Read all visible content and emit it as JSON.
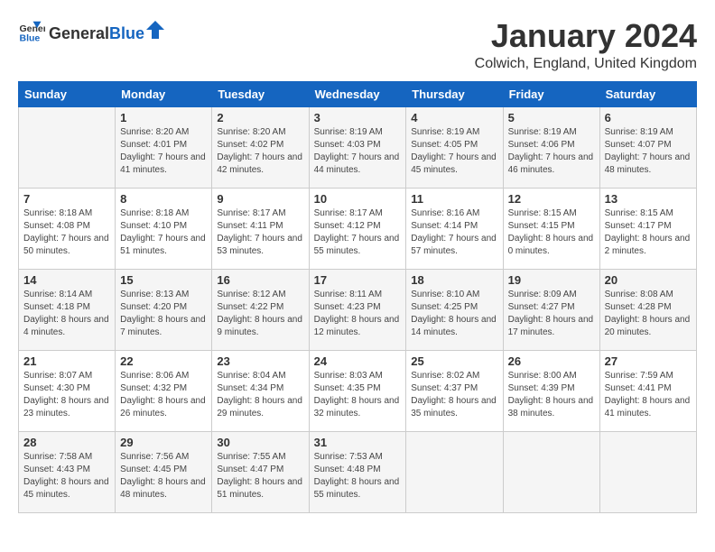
{
  "header": {
    "logo_general": "General",
    "logo_blue": "Blue",
    "month_title": "January 2024",
    "location": "Colwich, England, United Kingdom"
  },
  "days_of_week": [
    "Sunday",
    "Monday",
    "Tuesday",
    "Wednesday",
    "Thursday",
    "Friday",
    "Saturday"
  ],
  "weeks": [
    [
      {
        "day": "",
        "sunrise": "",
        "sunset": "",
        "daylight": ""
      },
      {
        "day": "1",
        "sunrise": "Sunrise: 8:20 AM",
        "sunset": "Sunset: 4:01 PM",
        "daylight": "Daylight: 7 hours and 41 minutes."
      },
      {
        "day": "2",
        "sunrise": "Sunrise: 8:20 AM",
        "sunset": "Sunset: 4:02 PM",
        "daylight": "Daylight: 7 hours and 42 minutes."
      },
      {
        "day": "3",
        "sunrise": "Sunrise: 8:19 AM",
        "sunset": "Sunset: 4:03 PM",
        "daylight": "Daylight: 7 hours and 44 minutes."
      },
      {
        "day": "4",
        "sunrise": "Sunrise: 8:19 AM",
        "sunset": "Sunset: 4:05 PM",
        "daylight": "Daylight: 7 hours and 45 minutes."
      },
      {
        "day": "5",
        "sunrise": "Sunrise: 8:19 AM",
        "sunset": "Sunset: 4:06 PM",
        "daylight": "Daylight: 7 hours and 46 minutes."
      },
      {
        "day": "6",
        "sunrise": "Sunrise: 8:19 AM",
        "sunset": "Sunset: 4:07 PM",
        "daylight": "Daylight: 7 hours and 48 minutes."
      }
    ],
    [
      {
        "day": "7",
        "sunrise": "Sunrise: 8:18 AM",
        "sunset": "Sunset: 4:08 PM",
        "daylight": "Daylight: 7 hours and 50 minutes."
      },
      {
        "day": "8",
        "sunrise": "Sunrise: 8:18 AM",
        "sunset": "Sunset: 4:10 PM",
        "daylight": "Daylight: 7 hours and 51 minutes."
      },
      {
        "day": "9",
        "sunrise": "Sunrise: 8:17 AM",
        "sunset": "Sunset: 4:11 PM",
        "daylight": "Daylight: 7 hours and 53 minutes."
      },
      {
        "day": "10",
        "sunrise": "Sunrise: 8:17 AM",
        "sunset": "Sunset: 4:12 PM",
        "daylight": "Daylight: 7 hours and 55 minutes."
      },
      {
        "day": "11",
        "sunrise": "Sunrise: 8:16 AM",
        "sunset": "Sunset: 4:14 PM",
        "daylight": "Daylight: 7 hours and 57 minutes."
      },
      {
        "day": "12",
        "sunrise": "Sunrise: 8:15 AM",
        "sunset": "Sunset: 4:15 PM",
        "daylight": "Daylight: 8 hours and 0 minutes."
      },
      {
        "day": "13",
        "sunrise": "Sunrise: 8:15 AM",
        "sunset": "Sunset: 4:17 PM",
        "daylight": "Daylight: 8 hours and 2 minutes."
      }
    ],
    [
      {
        "day": "14",
        "sunrise": "Sunrise: 8:14 AM",
        "sunset": "Sunset: 4:18 PM",
        "daylight": "Daylight: 8 hours and 4 minutes."
      },
      {
        "day": "15",
        "sunrise": "Sunrise: 8:13 AM",
        "sunset": "Sunset: 4:20 PM",
        "daylight": "Daylight: 8 hours and 7 minutes."
      },
      {
        "day": "16",
        "sunrise": "Sunrise: 8:12 AM",
        "sunset": "Sunset: 4:22 PM",
        "daylight": "Daylight: 8 hours and 9 minutes."
      },
      {
        "day": "17",
        "sunrise": "Sunrise: 8:11 AM",
        "sunset": "Sunset: 4:23 PM",
        "daylight": "Daylight: 8 hours and 12 minutes."
      },
      {
        "day": "18",
        "sunrise": "Sunrise: 8:10 AM",
        "sunset": "Sunset: 4:25 PM",
        "daylight": "Daylight: 8 hours and 14 minutes."
      },
      {
        "day": "19",
        "sunrise": "Sunrise: 8:09 AM",
        "sunset": "Sunset: 4:27 PM",
        "daylight": "Daylight: 8 hours and 17 minutes."
      },
      {
        "day": "20",
        "sunrise": "Sunrise: 8:08 AM",
        "sunset": "Sunset: 4:28 PM",
        "daylight": "Daylight: 8 hours and 20 minutes."
      }
    ],
    [
      {
        "day": "21",
        "sunrise": "Sunrise: 8:07 AM",
        "sunset": "Sunset: 4:30 PM",
        "daylight": "Daylight: 8 hours and 23 minutes."
      },
      {
        "day": "22",
        "sunrise": "Sunrise: 8:06 AM",
        "sunset": "Sunset: 4:32 PM",
        "daylight": "Daylight: 8 hours and 26 minutes."
      },
      {
        "day": "23",
        "sunrise": "Sunrise: 8:04 AM",
        "sunset": "Sunset: 4:34 PM",
        "daylight": "Daylight: 8 hours and 29 minutes."
      },
      {
        "day": "24",
        "sunrise": "Sunrise: 8:03 AM",
        "sunset": "Sunset: 4:35 PM",
        "daylight": "Daylight: 8 hours and 32 minutes."
      },
      {
        "day": "25",
        "sunrise": "Sunrise: 8:02 AM",
        "sunset": "Sunset: 4:37 PM",
        "daylight": "Daylight: 8 hours and 35 minutes."
      },
      {
        "day": "26",
        "sunrise": "Sunrise: 8:00 AM",
        "sunset": "Sunset: 4:39 PM",
        "daylight": "Daylight: 8 hours and 38 minutes."
      },
      {
        "day": "27",
        "sunrise": "Sunrise: 7:59 AM",
        "sunset": "Sunset: 4:41 PM",
        "daylight": "Daylight: 8 hours and 41 minutes."
      }
    ],
    [
      {
        "day": "28",
        "sunrise": "Sunrise: 7:58 AM",
        "sunset": "Sunset: 4:43 PM",
        "daylight": "Daylight: 8 hours and 45 minutes."
      },
      {
        "day": "29",
        "sunrise": "Sunrise: 7:56 AM",
        "sunset": "Sunset: 4:45 PM",
        "daylight": "Daylight: 8 hours and 48 minutes."
      },
      {
        "day": "30",
        "sunrise": "Sunrise: 7:55 AM",
        "sunset": "Sunset: 4:47 PM",
        "daylight": "Daylight: 8 hours and 51 minutes."
      },
      {
        "day": "31",
        "sunrise": "Sunrise: 7:53 AM",
        "sunset": "Sunset: 4:48 PM",
        "daylight": "Daylight: 8 hours and 55 minutes."
      },
      {
        "day": "",
        "sunrise": "",
        "sunset": "",
        "daylight": ""
      },
      {
        "day": "",
        "sunrise": "",
        "sunset": "",
        "daylight": ""
      },
      {
        "day": "",
        "sunrise": "",
        "sunset": "",
        "daylight": ""
      }
    ]
  ]
}
